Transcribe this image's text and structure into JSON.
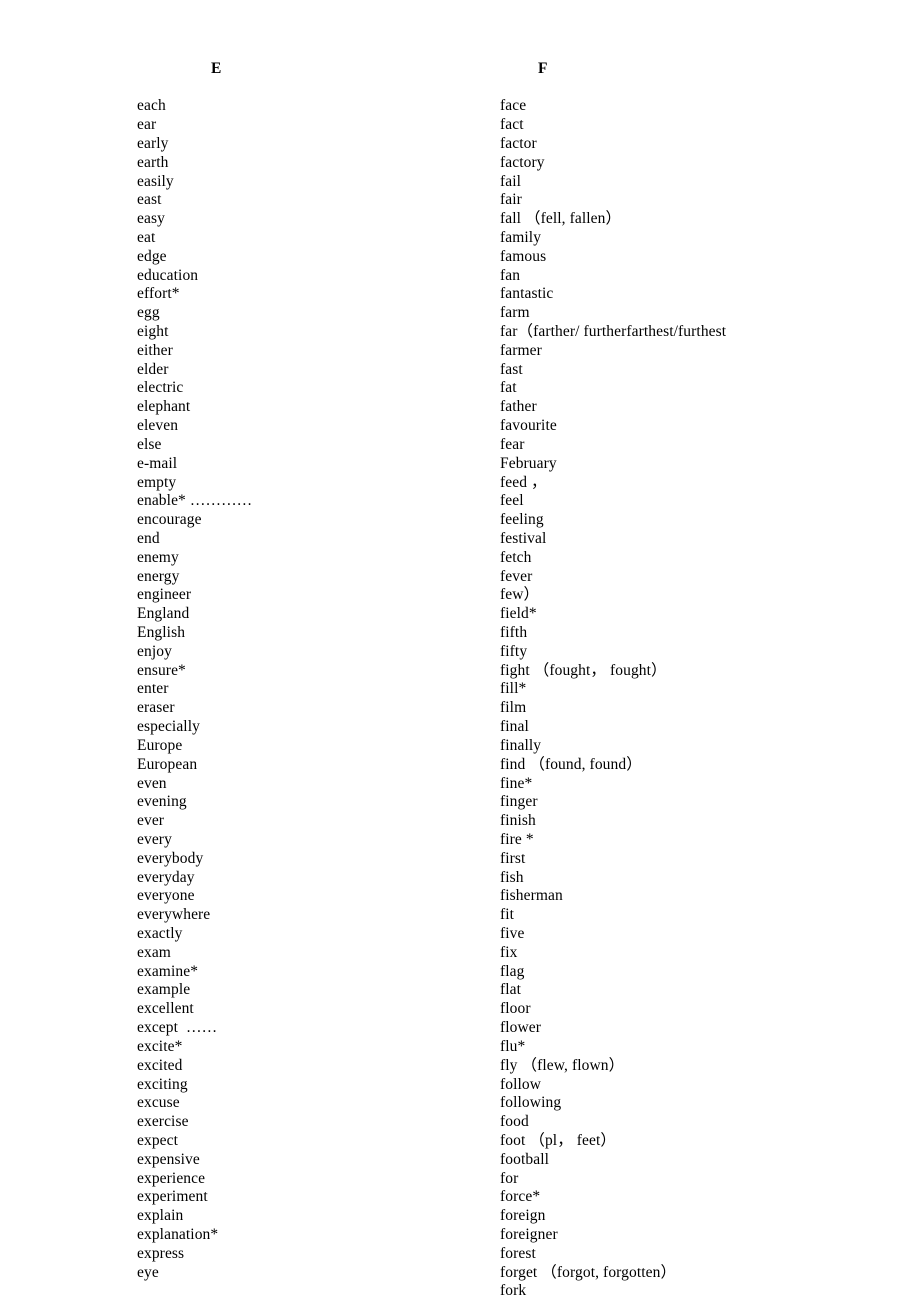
{
  "document": {
    "type": "vocabulary-word-list",
    "background_color": "#ffffff",
    "text_color": "#000000"
  },
  "columns": [
    {
      "heading": "E",
      "words": [
        "each",
        "ear",
        "early",
        "earth",
        "easily",
        "east",
        "easy",
        "eat",
        "edge",
        "education",
        "effort*",
        "egg",
        "eight",
        "either",
        "elder",
        "electric",
        "elephant",
        "eleven",
        "else",
        "e-mail",
        "empty",
        "enable* …………",
        "encourage",
        "end",
        "enemy",
        "energy",
        "engineer",
        "England",
        "English",
        "enjoy",
        "ensure*",
        "enter",
        "eraser",
        "especially",
        "Europe",
        "European",
        "even",
        "evening",
        "ever",
        "every",
        "everybody",
        "everyday",
        "everyone",
        "everywhere",
        "exactly",
        "exam",
        "examine*",
        "example",
        "excellent",
        "except  ……",
        "excite*",
        "excited",
        "exciting",
        "excuse",
        "exercise",
        "expect",
        "expensive",
        "experience",
        "experiment",
        "explain",
        "explanation*",
        "express",
        "eye"
      ]
    },
    {
      "heading": "F",
      "words": [
        "face",
        "fact",
        "factor",
        "factory",
        "fail",
        "fair",
        "fall （fell, fallen）",
        "family",
        "famous",
        "fan",
        "fantastic",
        "farm",
        "far（farther/ furtherfarthest/furthest",
        "farmer",
        "fast",
        "fat",
        "father",
        "favourite",
        "fear",
        "February",
        "feed ，",
        "feel",
        "feeling",
        "festival",
        "fetch",
        "fever",
        "few）",
        "field*",
        "fifth",
        "fifty",
        "fight （fought， fought）",
        "fill*",
        "film",
        "final",
        "finally",
        "find （found, found）",
        "fine*",
        "finger",
        "finish",
        "fire *",
        "first",
        "fish",
        "fisherman",
        "fit",
        "five",
        "fix",
        "flag",
        "flat",
        "floor",
        "flower",
        "flu*",
        "fly （flew, flown）",
        "follow",
        "following",
        "food",
        "foot （pl， feet）",
        "football",
        "for",
        "force*",
        "foreign",
        "foreigner",
        "forest",
        "forget （forgot, forgotten）",
        "fork"
      ]
    }
  ]
}
